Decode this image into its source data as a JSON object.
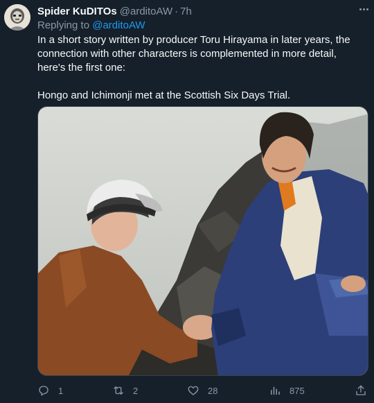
{
  "tweet": {
    "author": {
      "display_name": "Spider KuDITOs",
      "handle": "@arditoAW",
      "separator": "·",
      "time": "7h"
    },
    "reply": {
      "prefix": "Replying to",
      "handle": "@arditoAW"
    },
    "text": {
      "line1": "In a short story written by producer Toru Hirayama in later years, the connection with other characters is complemented in more detail, here's the first one:",
      "line2": "Hongo and Ichimonji met at the Scottish Six Days Trial."
    },
    "actions": {
      "replies": "1",
      "retweets": "2",
      "likes": "28",
      "views": "875"
    },
    "icons": {
      "more": "more-horizontal-icon",
      "reply": "comment-bubble-icon",
      "retweet": "retweet-icon",
      "like": "heart-icon",
      "views": "analytics-bars-icon",
      "share": "share-upload-icon"
    }
  },
  "colors": {
    "background": "#15202b",
    "text": "#f7f9f9",
    "secondary": "#8b98a5",
    "link": "#1d9bf0",
    "border": "#38444d"
  }
}
